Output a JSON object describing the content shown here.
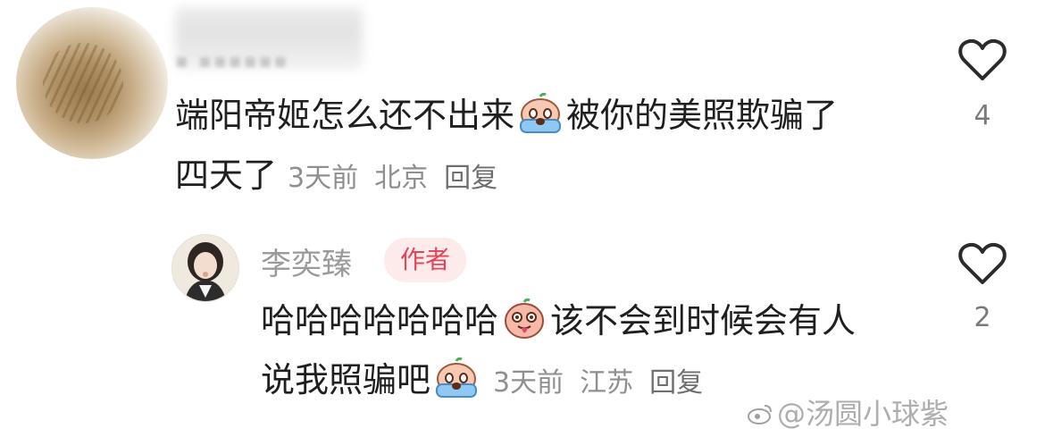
{
  "comment": {
    "line1": "端阳帝姬怎么还不出来",
    "line1_after_emoji": "被你的美照欺骗了",
    "line2": "四天了",
    "time": "3天前",
    "location": "北京",
    "reply_label": "回复",
    "like_count": "4",
    "emoji_icon": "crying-dumpling-emoji"
  },
  "reply": {
    "username": "李奕臻",
    "badge": "作者",
    "line1": "哈哈哈哈哈哈哈",
    "line1_after_emoji": "该不会到时候会有人",
    "line2": "说我照骗吧",
    "time": "3天前",
    "location": "江苏",
    "reply_label": "回复",
    "like_count": "2",
    "emoji_icons": [
      "tongue-out-dumpling-emoji",
      "crying-dumpling-emoji"
    ]
  },
  "watermark": {
    "text": "@汤圆小球紫"
  },
  "colors": {
    "text": "#1f1f1f",
    "meta": "#8f8f8f",
    "badge_bg": "#fdeaea",
    "badge_text": "#e2455a"
  }
}
